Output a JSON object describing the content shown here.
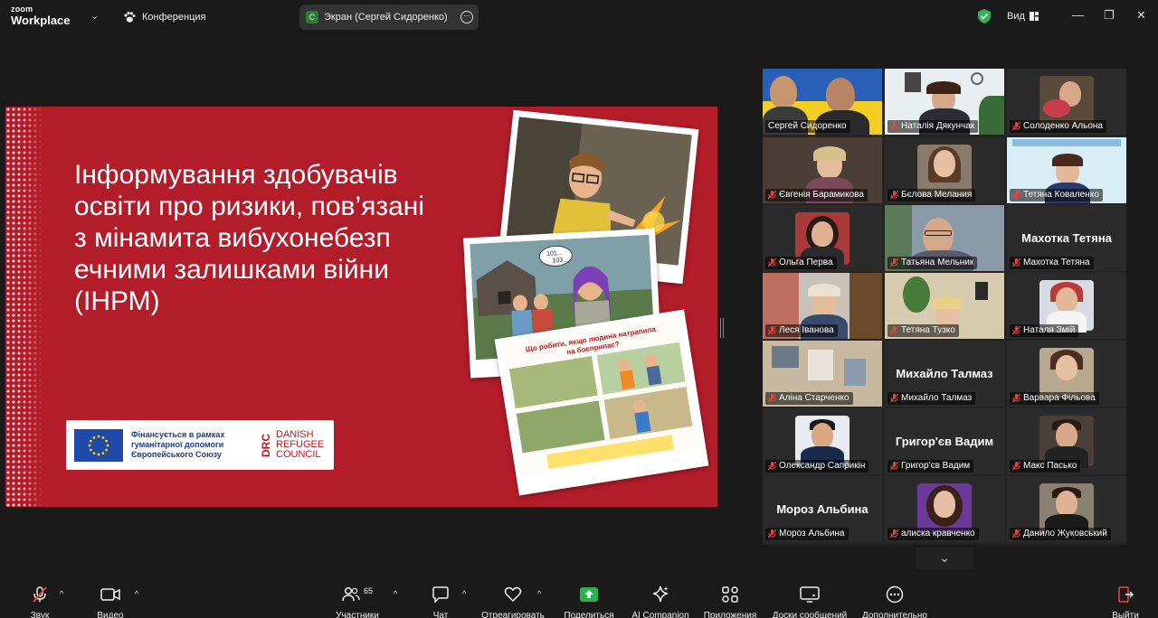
{
  "app": {
    "logo_line1": "zoom",
    "logo_line2": "Workplace",
    "meeting_type": "Конференция",
    "share_label": "Экран (Сергей Сидоренко)",
    "share_initial": "С",
    "view_label": "Вид",
    "accent_green": "#3fd15e",
    "brand_red": "#b31d2a"
  },
  "slide": {
    "title": "Інформування здобувачів освіти про ризики, пов’язані з мінамита вибухонебезп ечними залишками війни (ІНРМ)",
    "funding_text": "Фінансується в рамках гуманітарної допомоги Європейського Союзу",
    "drc_mark": "DRC",
    "drc_line1": "DANISH",
    "drc_line2": "REFUGEE",
    "drc_line3": "COUNCIL",
    "comic_bubble_1": "101...",
    "comic_bubble_2": "103...",
    "comic_heading": "Що робити, якщо людина натрапила на боєприпас?"
  },
  "participants": [
    {
      "name": "Сергей Сидоренко",
      "muted": false,
      "video": true,
      "speaking": true
    },
    {
      "name": "Наталія Дякунчак",
      "muted": true,
      "video": true
    },
    {
      "name": "Солоденко Альона",
      "muted": true,
      "video": true
    },
    {
      "name": "Євгенія Барамикова",
      "muted": true,
      "video": true
    },
    {
      "name": "Бєлова Мелания",
      "muted": true,
      "video": true
    },
    {
      "name": "Тетяна  Коваленко",
      "muted": true,
      "video": true
    },
    {
      "name": "Ольга Перва",
      "muted": true,
      "video": true
    },
    {
      "name": "Татьяна Мельник",
      "muted": true,
      "video": true
    },
    {
      "name": "Махотка Тетяна",
      "muted": true,
      "video": false,
      "display": "Махотка Тетяна"
    },
    {
      "name": "Леся Іванова",
      "muted": true,
      "video": true
    },
    {
      "name": "Тетяна Тузко",
      "muted": true,
      "video": true
    },
    {
      "name": "Наталя Змій",
      "muted": true,
      "video": true
    },
    {
      "name": "Аліна Старченко",
      "muted": true,
      "video": true
    },
    {
      "name": "Михайло Талмаз",
      "muted": true,
      "video": false,
      "display": "Михайло Талмаз"
    },
    {
      "name": "Варвара Фільова",
      "muted": true,
      "video": true
    },
    {
      "name": "Олександр Саприкін",
      "muted": true,
      "video": true
    },
    {
      "name": "Григор'єв Вадим",
      "muted": true,
      "video": false,
      "display": "Григор'єв Вадим"
    },
    {
      "name": "Макс Пасько",
      "muted": true,
      "video": true
    },
    {
      "name": "Мороз Альбина",
      "muted": true,
      "video": false,
      "display": "Мороз Альбина"
    },
    {
      "name": "алиска кравченко",
      "muted": true,
      "video": true
    },
    {
      "name": "Данило Жуковський",
      "muted": true,
      "video": true
    }
  ],
  "toolbar": {
    "audio": "Звук",
    "video": "Видео",
    "participants": "Участники",
    "participants_count": "65",
    "chat": "Чат",
    "react": "Отреагировать",
    "share": "Поделиться",
    "ai": "AI Companion",
    "apps": "Приложения",
    "whiteboards": "Доски сообщений",
    "more": "Дополнительно",
    "leave": "Выйти"
  }
}
